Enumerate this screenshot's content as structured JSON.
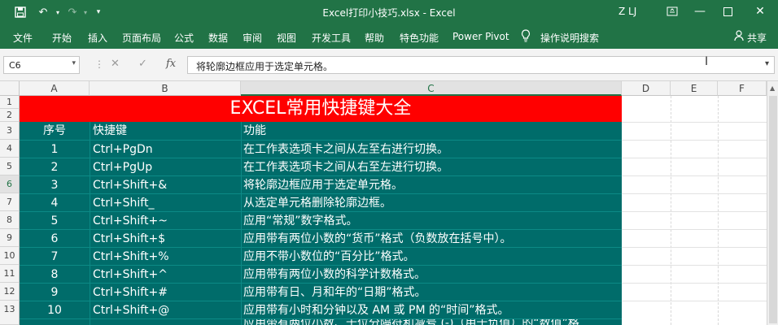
{
  "window": {
    "title": "Excel打印小技巧.xlsx - Excel",
    "user_initials": "Z LJ"
  },
  "quick_access": {
    "save_icon": "save-icon",
    "undo_icon": "undo-icon",
    "redo_icon": "redo-icon",
    "customize_icon": "customize-icon"
  },
  "menu": {
    "items": [
      "文件",
      "开始",
      "插入",
      "页面布局",
      "公式",
      "数据",
      "审阅",
      "视图",
      "开发工具",
      "帮助",
      "特色功能",
      "Power Pivot"
    ],
    "tell_me": "操作说明搜索",
    "share": "共享"
  },
  "formula_bar": {
    "name_box": "C6",
    "fx_label": "fx",
    "content": "将轮廓边框应用于选定单元格。"
  },
  "columns": [
    "A",
    "B",
    "C",
    "D",
    "E",
    "F"
  ],
  "rows": [
    "1",
    "2",
    "3",
    "4",
    "5",
    "6",
    "7",
    "8",
    "9",
    "10",
    "11",
    "12",
    "13"
  ],
  "sheet": {
    "title": "EXCEL常用快捷键大全",
    "header": {
      "seq": "序号",
      "key": "快捷键",
      "func": "功能"
    },
    "data": [
      {
        "seq": "1",
        "key": "Ctrl+PgDn",
        "func": "在工作表选项卡之间从左至右进行切换。"
      },
      {
        "seq": "2",
        "key": "Ctrl+PgUp",
        "func": "在工作表选项卡之间从右至左进行切换。"
      },
      {
        "seq": "3",
        "key": "Ctrl+Shift+&",
        "func": "将轮廓边框应用于选定单元格。"
      },
      {
        "seq": "4",
        "key": "Ctrl+Shift_",
        "func": "从选定单元格删除轮廓边框。"
      },
      {
        "seq": "5",
        "key": "Ctrl+Shift+~",
        "func": "应用“常规”数字格式。"
      },
      {
        "seq": "6",
        "key": "Ctrl+Shift+$",
        "func": "应用带有两位小数的“货币”格式（负数放在括号中）。"
      },
      {
        "seq": "7",
        "key": "Ctrl+Shift+%",
        "func": "应用不带小数位的“百分比”格式。"
      },
      {
        "seq": "8",
        "key": "Ctrl+Shift+^",
        "func": "应用带有两位小数的科学计数格式。"
      },
      {
        "seq": "9",
        "key": "Ctrl+Shift+#",
        "func": "应用带有日、月和年的“日期”格式。"
      },
      {
        "seq": "10",
        "key": "Ctrl+Shift+@",
        "func": "应用带有小时和分钟以及 AM 或 PM 的“时间”格式。"
      },
      {
        "seq": "",
        "key": "",
        "func": "应用带有两位小数、千位分隔符和减号 (-)（用于负值）的“数值”格"
      }
    ]
  },
  "colors": {
    "excel_green": "#217346",
    "title_red": "#ff0000",
    "table_teal": "#006c6a"
  }
}
